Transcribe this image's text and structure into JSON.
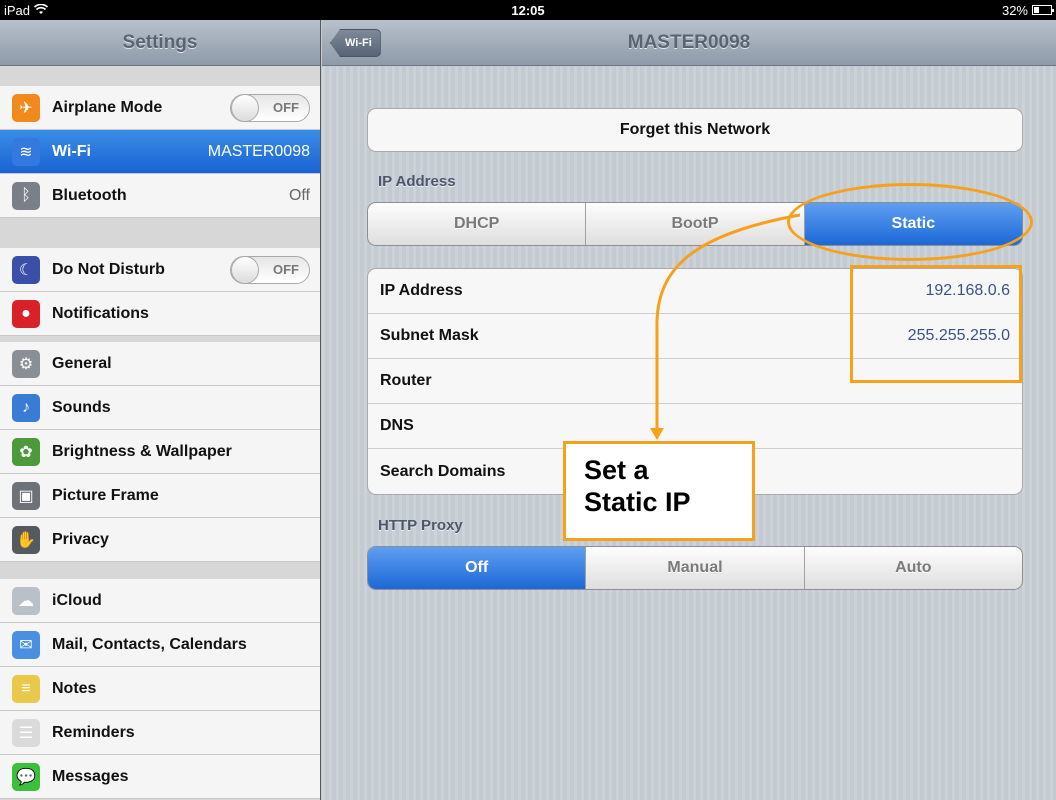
{
  "status_bar": {
    "device": "iPad",
    "time": "12:05",
    "battery": "32%",
    "battery_level": 0.32
  },
  "sidebar": {
    "title": "Settings",
    "groups": [
      [
        {
          "label": "Airplane Mode",
          "toggle": "OFF",
          "icon": "airplane-icon",
          "color": "#f08a1c"
        },
        {
          "label": "Wi-Fi",
          "value": "MASTER0098",
          "icon": "wifi-icon",
          "color": "#3479df",
          "selected": true
        },
        {
          "label": "Bluetooth",
          "value": "Off",
          "icon": "bluetooth-icon",
          "color": "#7a8087"
        }
      ],
      [
        {
          "label": "Do Not Disturb",
          "toggle": "OFF",
          "icon": "moon-icon",
          "color": "#3b4fa8"
        },
        {
          "label": "Notifications",
          "icon": "notifications-icon",
          "color": "#d9212a"
        }
      ],
      [
        {
          "label": "General",
          "icon": "gear-icon",
          "color": "#8a8f96"
        },
        {
          "label": "Sounds",
          "icon": "speaker-icon",
          "color": "#3a7bd5"
        },
        {
          "label": "Brightness & Wallpaper",
          "icon": "flower-icon",
          "color": "#4c9a3a"
        },
        {
          "label": "Picture Frame",
          "icon": "picture-frame-icon",
          "color": "#6e7278"
        },
        {
          "label": "Privacy",
          "icon": "hand-icon",
          "color": "#555a61"
        }
      ],
      [
        {
          "label": "iCloud",
          "icon": "cloud-icon",
          "color": "#b9c0c8"
        },
        {
          "label": "Mail, Contacts, Calendars",
          "icon": "mail-icon",
          "color": "#4a8fe0"
        },
        {
          "label": "Notes",
          "icon": "notes-icon",
          "color": "#e8c94b"
        },
        {
          "label": "Reminders",
          "icon": "reminders-icon",
          "color": "#dadada"
        },
        {
          "label": "Messages",
          "icon": "messages-icon",
          "color": "#3cbf3a"
        }
      ]
    ]
  },
  "navbar": {
    "back_label": "Wi-Fi",
    "title": "MASTER0098"
  },
  "forget_button": "Forget this Network",
  "ip_section": {
    "label": "IP Address",
    "modes": [
      "DHCP",
      "BootP",
      "Static"
    ],
    "active_mode": "Static",
    "rows": [
      {
        "key": "IP Address",
        "value": "192.168.0.6"
      },
      {
        "key": "Subnet Mask",
        "value": "255.255.255.0"
      },
      {
        "key": "Router",
        "value": ""
      },
      {
        "key": "DNS",
        "value": ""
      },
      {
        "key": "Search Domains",
        "value": ""
      }
    ]
  },
  "proxy_section": {
    "label": "HTTP Proxy",
    "modes": [
      "Off",
      "Manual",
      "Auto"
    ],
    "active_mode": "Off"
  },
  "annotation": {
    "text_line1": "Set a",
    "text_line2": "Static IP",
    "color": "#f7a11a"
  }
}
